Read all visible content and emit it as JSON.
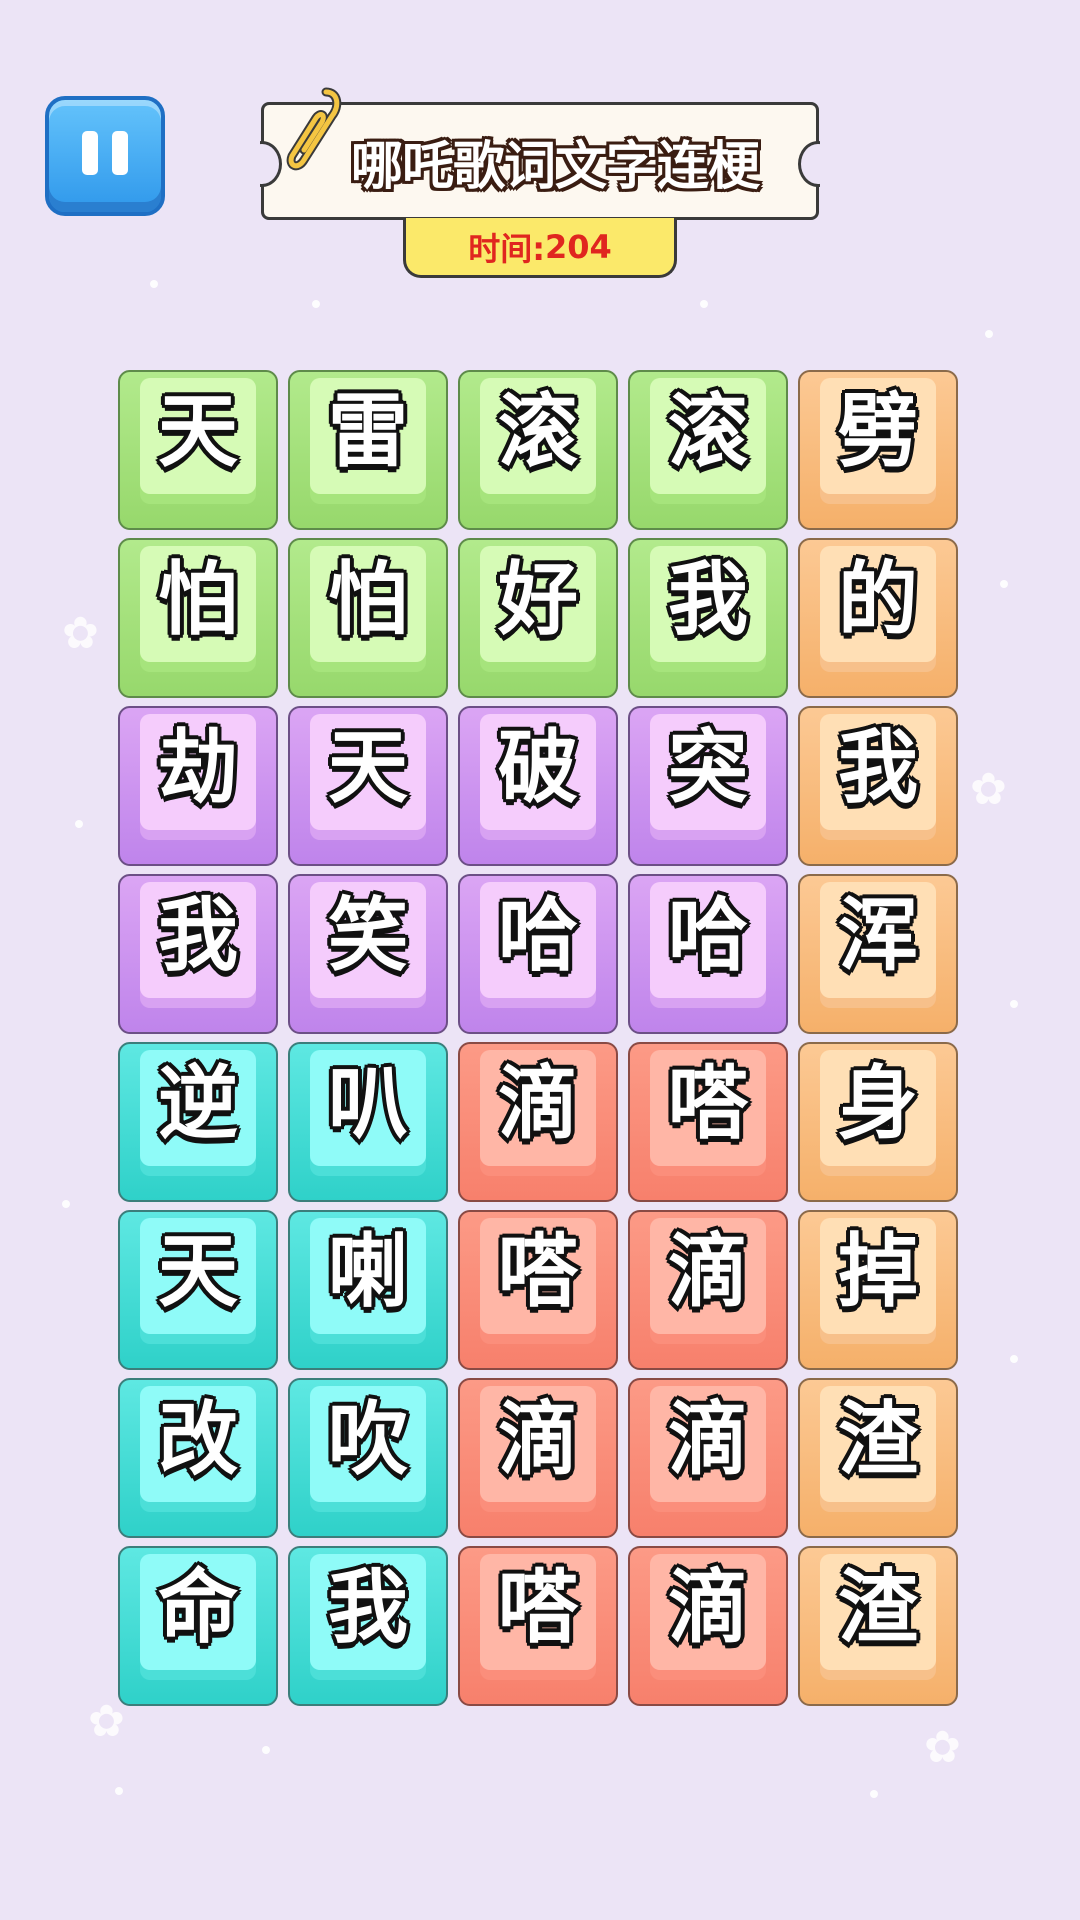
{
  "header": {
    "title": "哪吒歌词文字连梗",
    "timer_label": "时间:",
    "timer_value": "204",
    "pause_icon": "pause-icon"
  },
  "colors": {
    "green": "#b2ea8c",
    "orange": "#fcc994",
    "purple": "#dba5f4",
    "cyan": "#5ee8e2",
    "red": "#fc9a86",
    "timer_text": "#e0261f",
    "background": "#ece4f6"
  },
  "board": {
    "columns": 5,
    "rows": 8,
    "tiles": [
      {
        "char": "天",
        "color": "green"
      },
      {
        "char": "雷",
        "color": "green"
      },
      {
        "char": "滚",
        "color": "green"
      },
      {
        "char": "滚",
        "color": "green"
      },
      {
        "char": "劈",
        "color": "orange"
      },
      {
        "char": "怕",
        "color": "green"
      },
      {
        "char": "怕",
        "color": "green"
      },
      {
        "char": "好",
        "color": "green"
      },
      {
        "char": "我",
        "color": "green"
      },
      {
        "char": "的",
        "color": "orange"
      },
      {
        "char": "劫",
        "color": "purple"
      },
      {
        "char": "天",
        "color": "purple"
      },
      {
        "char": "破",
        "color": "purple"
      },
      {
        "char": "突",
        "color": "purple"
      },
      {
        "char": "我",
        "color": "orange"
      },
      {
        "char": "我",
        "color": "purple"
      },
      {
        "char": "笑",
        "color": "purple"
      },
      {
        "char": "哈",
        "color": "purple"
      },
      {
        "char": "哈",
        "color": "purple"
      },
      {
        "char": "浑",
        "color": "orange"
      },
      {
        "char": "逆",
        "color": "cyan"
      },
      {
        "char": "叭",
        "color": "cyan"
      },
      {
        "char": "滴",
        "color": "red"
      },
      {
        "char": "嗒",
        "color": "red"
      },
      {
        "char": "身",
        "color": "orange"
      },
      {
        "char": "天",
        "color": "cyan"
      },
      {
        "char": "喇",
        "color": "cyan"
      },
      {
        "char": "嗒",
        "color": "red"
      },
      {
        "char": "滴",
        "color": "red"
      },
      {
        "char": "掉",
        "color": "orange"
      },
      {
        "char": "改",
        "color": "cyan"
      },
      {
        "char": "吹",
        "color": "cyan"
      },
      {
        "char": "滴",
        "color": "red"
      },
      {
        "char": "滴",
        "color": "red"
      },
      {
        "char": "渣",
        "color": "orange"
      },
      {
        "char": "命",
        "color": "cyan"
      },
      {
        "char": "我",
        "color": "cyan"
      },
      {
        "char": "嗒",
        "color": "red"
      },
      {
        "char": "滴",
        "color": "red"
      },
      {
        "char": "渣",
        "color": "orange"
      }
    ]
  }
}
